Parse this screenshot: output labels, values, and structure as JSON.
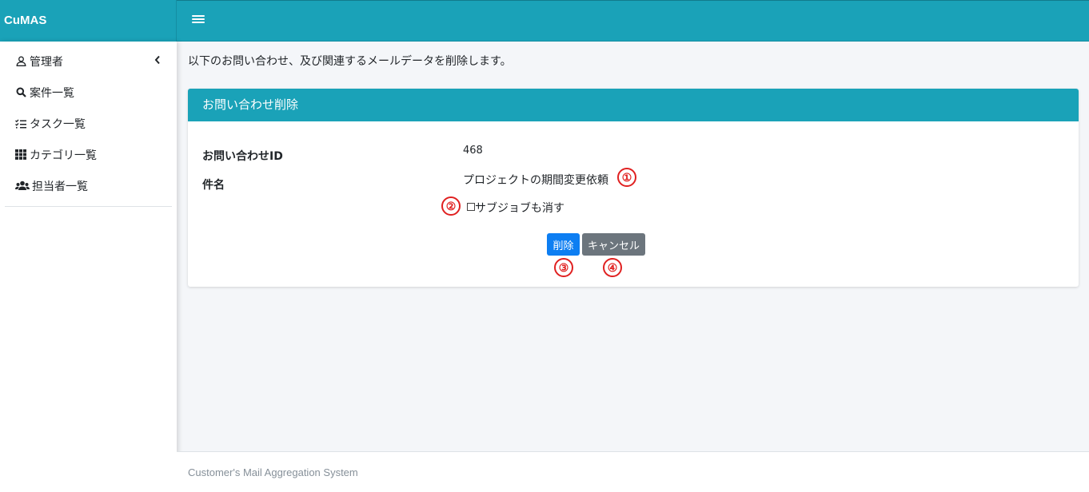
{
  "app": {
    "title": "CuMAS",
    "accent": "#1aa2b8"
  },
  "sidebar": {
    "items": [
      {
        "label": "管理者",
        "icon": "user-icon"
      },
      {
        "label": "案件一覧",
        "icon": "search-icon"
      },
      {
        "label": "タスク一覧",
        "icon": "task-list-icon"
      },
      {
        "label": "カテゴリ一覧",
        "icon": "grid-icon"
      },
      {
        "label": "担当者一覧",
        "icon": "users-icon"
      }
    ]
  },
  "main": {
    "notice": "以下のお問い合わせ、及び関連するメールデータを削除します。",
    "card": {
      "title": "お問い合わせ削除",
      "fields": [
        {
          "label": "お問い合わせID",
          "value": "468"
        },
        {
          "label": "件名",
          "value": "プロジェクトの期間変更依頼"
        }
      ],
      "checkbox_label": "サブジョブも消す",
      "checkbox_checked": false,
      "delete_label": "削除",
      "cancel_label": "キャンセル"
    },
    "annotations": [
      "①",
      "②",
      "③",
      "④"
    ]
  },
  "footer": {
    "text": "Customer's Mail Aggregation System"
  }
}
